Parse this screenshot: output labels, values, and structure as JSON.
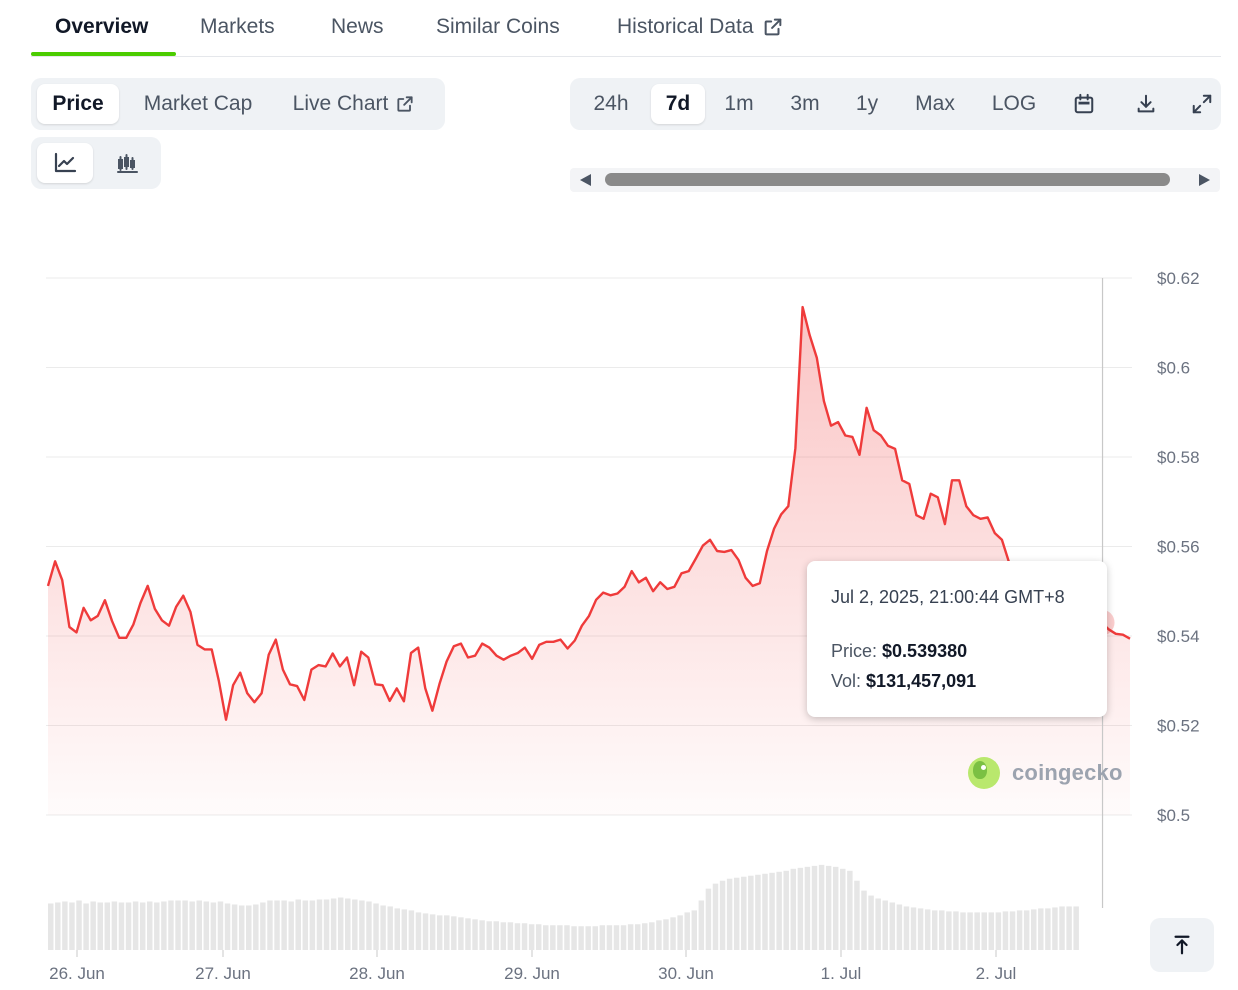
{
  "tabs": [
    {
      "label": "Overview",
      "active": true
    },
    {
      "label": "Markets"
    },
    {
      "label": "News"
    },
    {
      "label": "Similar Coins"
    },
    {
      "label": "Historical Data",
      "icon": "external-link-icon"
    }
  ],
  "metric_tabs": [
    {
      "label": "Price",
      "active": true
    },
    {
      "label": "Market Cap"
    },
    {
      "label": "Live Chart",
      "icon": "external-link-icon"
    }
  ],
  "chart_style_buttons": [
    {
      "icon": "line-chart-icon",
      "active": true
    },
    {
      "icon": "candlestick-chart-icon"
    }
  ],
  "range_buttons": [
    {
      "label": "24h"
    },
    {
      "label": "7d",
      "active": true
    },
    {
      "label": "1m"
    },
    {
      "label": "3m"
    },
    {
      "label": "1y"
    },
    {
      "label": "Max"
    },
    {
      "label": "LOG"
    }
  ],
  "tool_icons": [
    "calendar-icon",
    "download-icon",
    "expand-icon"
  ],
  "tooltip": {
    "date": "Jul 2, 2025, 21:00:44 GMT+8",
    "price_label": "Price:",
    "price_value": "$0.539380",
    "vol_label": "Vol:",
    "vol_value": "$131,457,091"
  },
  "logo": {
    "text": "coingecko"
  },
  "colors": {
    "line": "#ef3b3b",
    "accent": "#4bcc00",
    "volume": "#e6e6e6"
  },
  "chart_data": {
    "type": "line",
    "series": [
      {
        "values": [
          0.5512,
          0.5567,
          0.5525,
          0.542,
          0.5408,
          0.5463,
          0.5435,
          0.5445,
          0.548,
          0.5433,
          0.5396,
          0.5396,
          0.5426,
          0.5474,
          0.5512,
          0.5461,
          0.5435,
          0.5423,
          0.5465,
          0.549,
          0.5454,
          0.538,
          0.537,
          0.537,
          0.53,
          0.5213,
          0.529,
          0.5318,
          0.5272,
          0.5252,
          0.5272,
          0.5358,
          0.5392,
          0.5325,
          0.5292,
          0.5288,
          0.5257,
          0.5325,
          0.5335,
          0.5332,
          0.5361,
          0.5332,
          0.5352,
          0.529,
          0.5365,
          0.5352,
          0.5292,
          0.529,
          0.5255,
          0.5283,
          0.5254,
          0.5362,
          0.5374,
          0.5283,
          0.5233,
          0.5293,
          0.5343,
          0.5377,
          0.5383,
          0.5352,
          0.5356,
          0.5383,
          0.5374,
          0.5356,
          0.5347,
          0.5356,
          0.5362,
          0.5374,
          0.5349,
          0.538,
          0.5387,
          0.5387,
          0.5392,
          0.5372,
          0.539,
          0.5423,
          0.5445,
          0.5481,
          0.5497,
          0.5491,
          0.5495,
          0.551,
          0.5545,
          0.552,
          0.553,
          0.55,
          0.552,
          0.5505,
          0.551,
          0.554,
          0.5545,
          0.5573,
          0.5602,
          0.5615,
          0.559,
          0.5588,
          0.5592,
          0.557,
          0.553,
          0.5512,
          0.5518,
          0.559,
          0.564,
          0.5672,
          0.569,
          0.582,
          0.6135,
          0.6072,
          0.6022,
          0.5925,
          0.587,
          0.5878,
          0.5848,
          0.5845,
          0.5805,
          0.591,
          0.586,
          0.5848,
          0.5825,
          0.5818,
          0.5748,
          0.574,
          0.567,
          0.5662,
          0.5718,
          0.571,
          0.565,
          0.5748,
          0.5748,
          0.569,
          0.567,
          0.5662,
          0.5665,
          0.563,
          0.5615,
          0.5565,
          0.552,
          0.548,
          0.546,
          0.544,
          0.543,
          0.542,
          0.5415,
          0.541,
          0.542,
          0.543,
          0.544,
          0.5447,
          0.543,
          0.5415,
          0.5405,
          0.5403,
          0.5394
        ],
        "volume": [
          47,
          48,
          49,
          48,
          50,
          47,
          49,
          48,
          48,
          49,
          48,
          48,
          49,
          48,
          49,
          48,
          49,
          50,
          50,
          50,
          49,
          50,
          49,
          48,
          49,
          47,
          46,
          45,
          45,
          46,
          48,
          50,
          50,
          50,
          49,
          51,
          50,
          50,
          51,
          51,
          52,
          53,
          52,
          51,
          50,
          49,
          47,
          45,
          44,
          42,
          41,
          40,
          38,
          37,
          36,
          35,
          35,
          34,
          33,
          32,
          31,
          30,
          29,
          29,
          28,
          28,
          27,
          27,
          26,
          26,
          25,
          25,
          25,
          25,
          24,
          24,
          24,
          24,
          25,
          25,
          25,
          25,
          26,
          26,
          27,
          28,
          30,
          31,
          33,
          35,
          38,
          40,
          50,
          62,
          67,
          70,
          72,
          73,
          74,
          75,
          76,
          77,
          78,
          79,
          80,
          82,
          83,
          84,
          85,
          86,
          85,
          84,
          82,
          80,
          70,
          60,
          55,
          52,
          50,
          48,
          46,
          44,
          43,
          42,
          41,
          40,
          40,
          39,
          39,
          38,
          38,
          38,
          38,
          38,
          38,
          39,
          39,
          40,
          40,
          41,
          42,
          42,
          43,
          44,
          44,
          44
        ]
      }
    ],
    "x_ticks": [
      "26. Jun",
      "27. Jun",
      "28. Jun",
      "29. Jun",
      "30. Jun",
      "1. Jul",
      "2. Jul"
    ],
    "y_ticks": [
      "$0.62",
      "$0.6",
      "$0.58",
      "$0.56",
      "$0.54",
      "$0.52",
      "$0.5"
    ],
    "ylim": [
      0.5,
      0.62
    ],
    "grid": true,
    "highlight_index": 148
  }
}
